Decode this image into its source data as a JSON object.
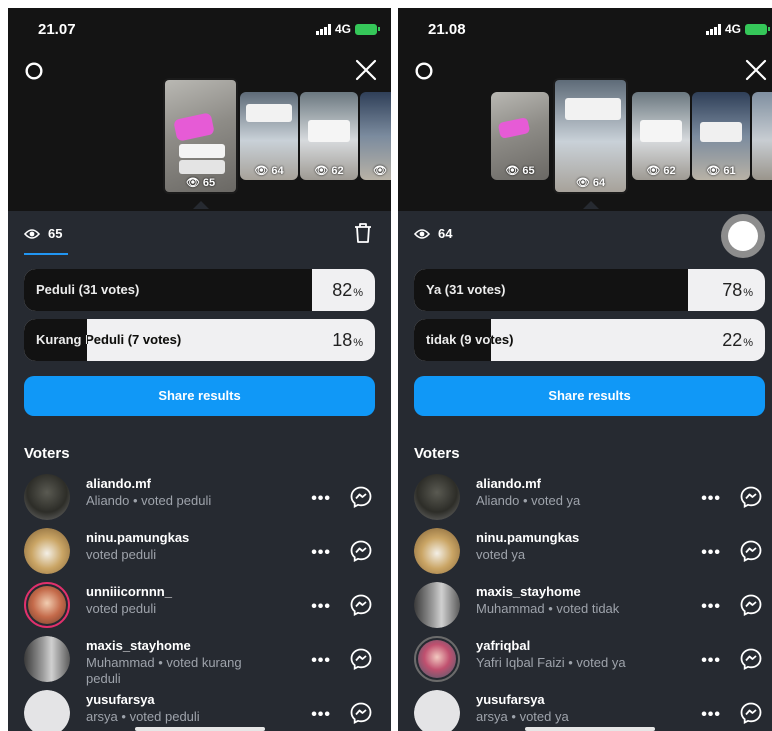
{
  "left": {
    "status": {
      "time": "21.07",
      "network": "4G"
    },
    "thumbs": [
      "65",
      "64",
      "62",
      ""
    ],
    "views": "65",
    "poll": [
      {
        "label": "Peduli (31 votes)",
        "percent": "82",
        "fraction": 0.82
      },
      {
        "label": "Kurang Peduli (7 votes)",
        "percent": "18",
        "fraction": 0.18
      }
    ],
    "share_label": "Share results",
    "voters_title": "Voters",
    "voters": [
      {
        "username": "aliando.mf",
        "detail": "Aliando • voted peduli"
      },
      {
        "username": "ninu.pamungkas",
        "detail": "voted peduli"
      },
      {
        "username": "unniiicornnn_",
        "detail": "voted peduli"
      },
      {
        "username": "maxis_stayhome",
        "detail": "Muhammad • voted kurang peduli"
      },
      {
        "username": "yusufarsya",
        "detail": "arsya • voted peduli"
      }
    ]
  },
  "right": {
    "status": {
      "time": "21.08",
      "network": "4G"
    },
    "thumbs": [
      "65",
      "64",
      "62",
      "61",
      ""
    ],
    "views": "64",
    "poll": [
      {
        "label": "Ya (31 votes)",
        "percent": "78",
        "fraction": 0.78
      },
      {
        "label": "tidak (9 votes)",
        "percent": "22",
        "fraction": 0.22
      }
    ],
    "share_label": "Share results",
    "voters_title": "Voters",
    "voters": [
      {
        "username": "aliando.mf",
        "detail": "Aliando • voted ya"
      },
      {
        "username": "ninu.pamungkas",
        "detail": "voted ya"
      },
      {
        "username": "maxis_stayhome",
        "detail": "Muhammad • voted tidak"
      },
      {
        "username": "yafriqbal",
        "detail": "Yafri Iqbal Faizi • voted ya"
      },
      {
        "username": "yusufarsya",
        "detail": "arsya • voted ya"
      }
    ]
  },
  "percent_sign": "%",
  "icons": {
    "settings": "settings-gear-icon",
    "close": "close-icon",
    "eye": "eye-icon",
    "trash": "trash-icon",
    "more": "more-dots-icon",
    "message": "messenger-icon"
  },
  "colors": {
    "accent": "#1098f7",
    "panel": "#262a31",
    "bar_fill": "#121212",
    "bar_bg": "#f0f0f2"
  }
}
